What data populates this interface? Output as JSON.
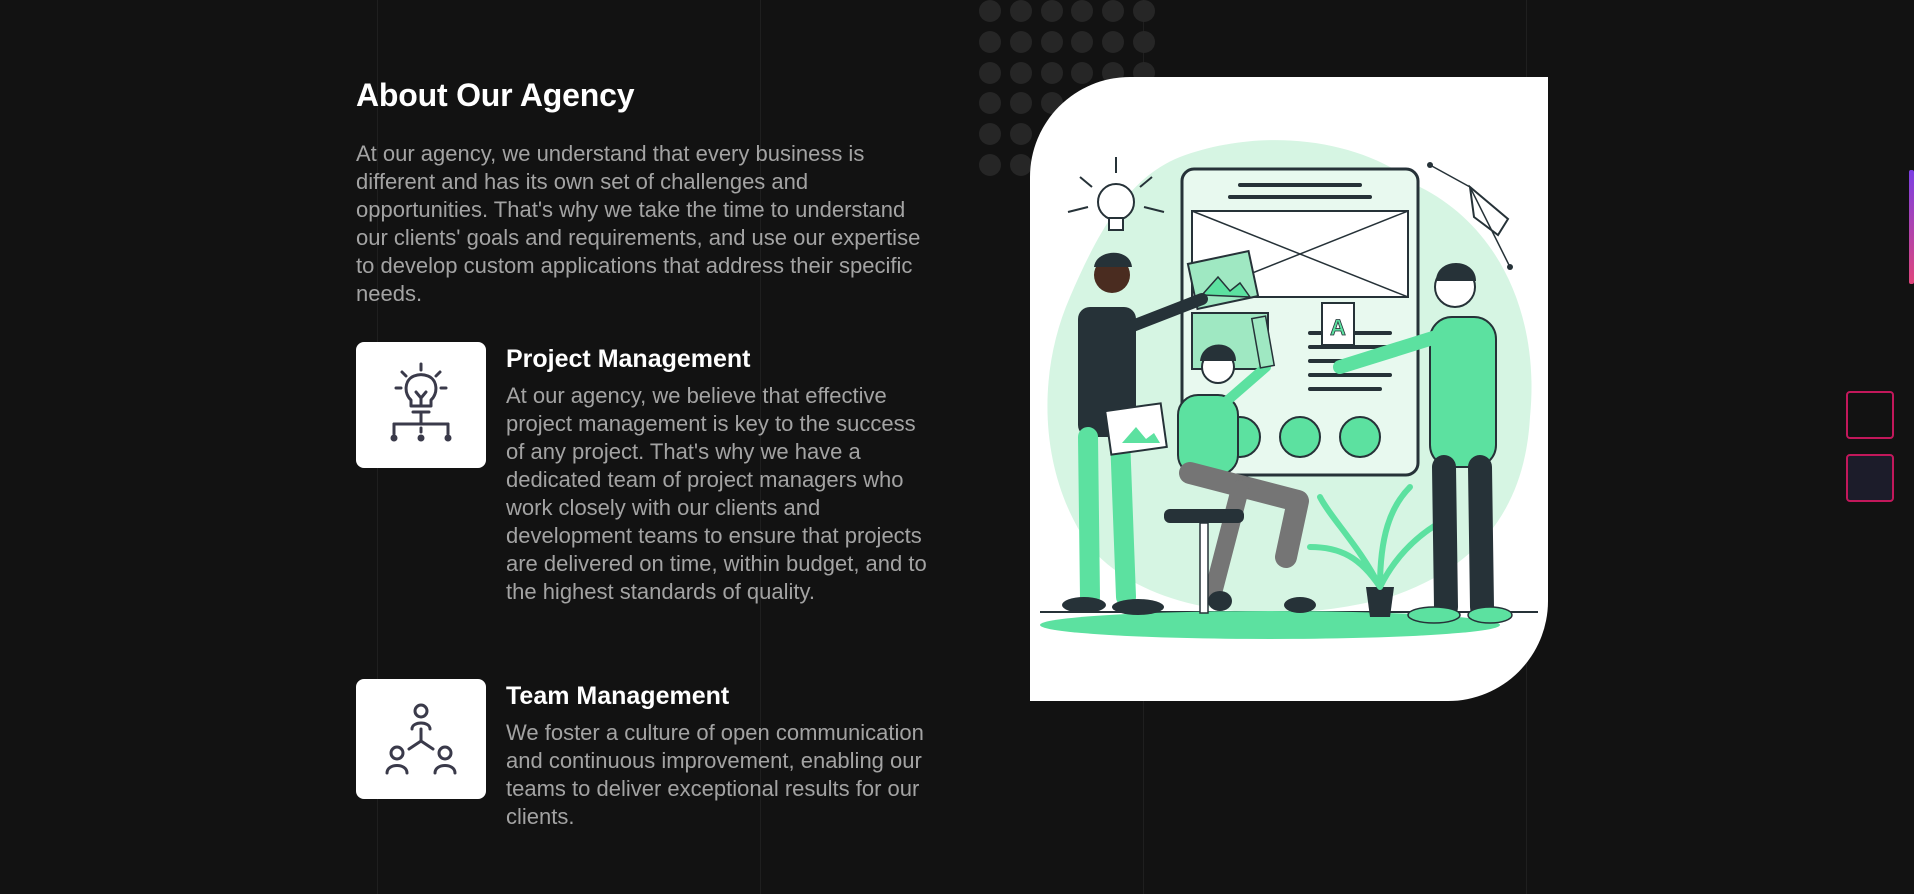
{
  "about": {
    "title": "About Our Agency",
    "intro": "At our agency, we understand that every business is different and has its own set of challenges and opportunities. That's why we take the time to understand our clients' goals and requirements, and use our expertise to develop custom applications that address their specific needs."
  },
  "features": [
    {
      "icon": "lightbulb-network-icon",
      "title": "Project Management",
      "description": "At our agency, we believe that effective project management is key to the success of any project. That's why we have a dedicated team of project managers who work closely with our clients and development teams to ensure that projects are delivered on time, within budget, and to the highest standards of quality."
    },
    {
      "icon": "team-hierarchy-icon",
      "title": "Team Management",
      "description": "We foster a culture of open communication and continuous improvement, enabling our teams to deliver exceptional results for our clients."
    }
  ],
  "illustration": {
    "icon": "team-collaboration-illustration"
  },
  "colors": {
    "background": "#121212",
    "accent_green": "#5ce1a0",
    "side_button_border": "#c2185b"
  }
}
